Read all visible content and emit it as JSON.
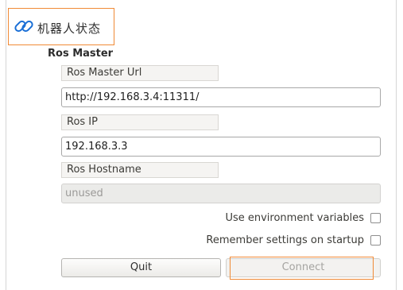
{
  "header": {
    "title": "机器人状态",
    "icon": "link-icon"
  },
  "ros_master": {
    "section_title": "Ros Master",
    "url_label": "Ros Master Url",
    "url_value": "http://192.168.3.4:11311/",
    "ip_label": "Ros IP",
    "ip_value": "192.168.3.3",
    "hostname_label": "Ros Hostname",
    "hostname_value": "unused"
  },
  "options": {
    "use_env_label": "Use environment variables",
    "use_env_checked": false,
    "remember_label": "Remember settings on startup",
    "remember_checked": false
  },
  "buttons": {
    "quit": "Quit",
    "connect": "Connect"
  },
  "colors": {
    "highlight": "#f08a36",
    "link_icon": "#1a6fd6"
  }
}
